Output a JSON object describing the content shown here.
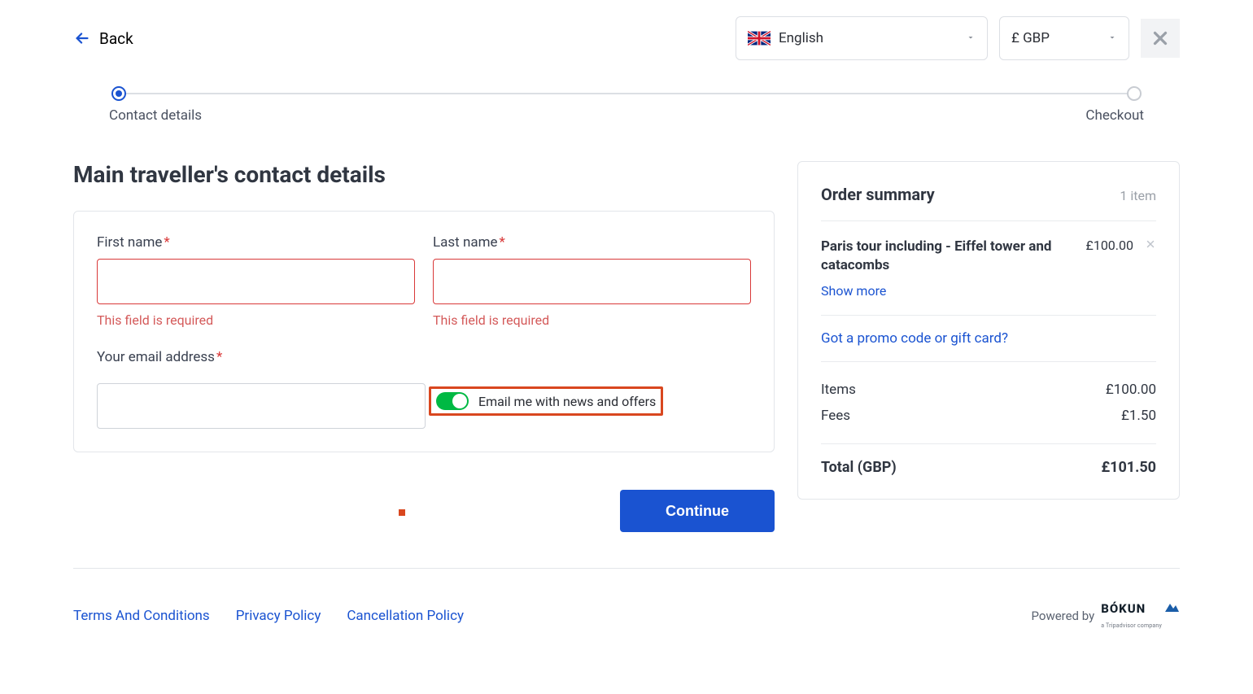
{
  "topbar": {
    "back_label": "Back",
    "language_label": "English",
    "currency_label": "£ GBP"
  },
  "progress": {
    "step1": "Contact details",
    "step2": "Checkout"
  },
  "page_title": "Main traveller's contact details",
  "form": {
    "first_name_label": "First name",
    "last_name_label": "Last name",
    "email_label": "Your email address",
    "required_error": "This field is required",
    "opt_in_label": "Email me with news and offers"
  },
  "summary": {
    "title": "Order summary",
    "item_count": "1 item",
    "item_name": "Paris tour including - Eiffel tower and catacombs",
    "item_price": "£100.00",
    "show_more": "Show more",
    "promo_link": "Got a promo code or gift card?",
    "items_label": "Items",
    "items_value": "£100.00",
    "fees_label": "Fees",
    "fees_value": "£1.50",
    "total_label": "Total (GBP)",
    "total_value": "£101.50"
  },
  "continue_label": "Continue",
  "footer": {
    "terms": "Terms And Conditions",
    "privacy": "Privacy Policy",
    "cancellation": "Cancellation Policy",
    "powered_by": "Powered by"
  }
}
